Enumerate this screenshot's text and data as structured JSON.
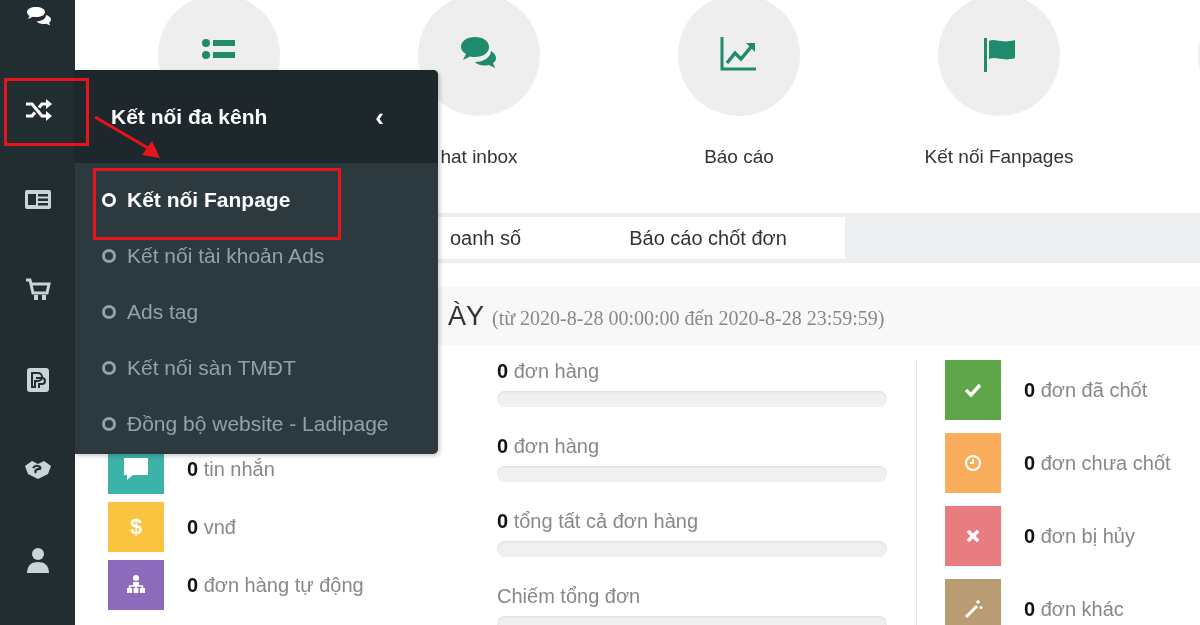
{
  "shortcuts": [
    {
      "kind": "list"
    },
    {
      "kind": "chat",
      "label": "hat inbox"
    },
    {
      "kind": "chart",
      "label": "Báo cáo"
    },
    {
      "kind": "flag",
      "label": "Kết nối Fanpages"
    },
    {
      "kind": "blank"
    }
  ],
  "tabs": [
    {
      "label": "oanh số"
    },
    {
      "label": "Báo cáo chốt đơn"
    }
  ],
  "period": {
    "title": "ÀY",
    "range": "(từ 2020-8-28 00:00:00 đến 2020-8-28 23:59:59)"
  },
  "left_stats": [
    {
      "kind": "message",
      "count": "0",
      "label": "tin nhắn",
      "color": "#3bb3a9"
    },
    {
      "kind": "money",
      "icon": "$",
      "count": "0",
      "label": "vnđ",
      "color": "#fbc440"
    },
    {
      "kind": "people",
      "count": "0",
      "label": "đơn hàng tự động",
      "color": "#8c6bbd"
    }
  ],
  "middle_stats": [
    {
      "count": "0",
      "label": "đơn hàng",
      "level": 0
    },
    {
      "count": "0",
      "label": "đơn hàng",
      "level": 0
    },
    {
      "count": "0",
      "label": "tổng tất cả đơn hàng",
      "level": 0
    },
    {
      "label": "Chiếm tổng đơn",
      "level": 0
    }
  ],
  "right_stats": [
    {
      "kind": "check",
      "count": "0",
      "label": "đơn đã chốt",
      "color": "#5fa54a"
    },
    {
      "kind": "clock",
      "count": "0",
      "label": "đơn chưa chốt",
      "color": "#f9ad5c"
    },
    {
      "kind": "cross",
      "count": "0",
      "label": "đơn bị hủy",
      "color": "#e77d80"
    },
    {
      "kind": "wand",
      "count": "0",
      "label": "đơn khác",
      "color": "#b99b74"
    }
  ],
  "menu": {
    "title": "Kết nối đa kênh",
    "collapse": "‹",
    "items": [
      {
        "label": "Kết nối Fanpage",
        "selected": true
      },
      {
        "label": "Kết nối tài khoản Ads",
        "selected": false
      },
      {
        "label": "Ads tag",
        "selected": false
      },
      {
        "label": "Kết nối sàn TMĐT",
        "selected": false
      },
      {
        "label": "Đồng bộ website - Ladipage",
        "selected": false
      }
    ]
  }
}
